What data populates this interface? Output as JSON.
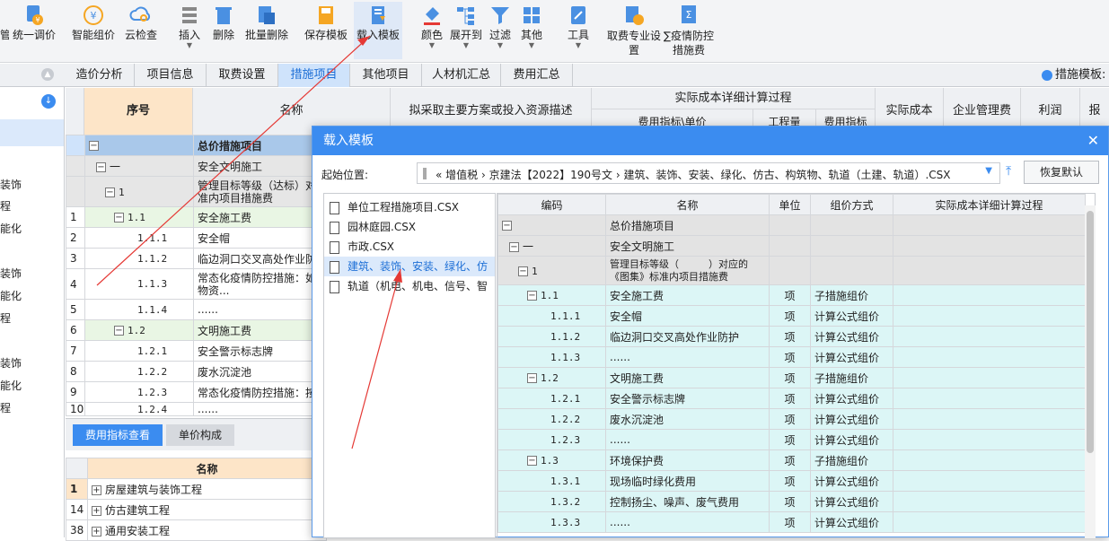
{
  "toolbar": {
    "items": [
      {
        "label": "管",
        "icon": "partial-icon"
      },
      {
        "label": "统一调价",
        "icon": "unified-price-icon"
      },
      {
        "label": "智能组价",
        "icon": "smart-pricing-icon"
      },
      {
        "label": "云检查",
        "icon": "cloud-check-icon"
      },
      {
        "label": "插入",
        "icon": "insert-icon"
      },
      {
        "label": "删除",
        "icon": "trash-icon"
      },
      {
        "label": "批量删除",
        "icon": "batch-delete-icon"
      },
      {
        "label": "保存模板",
        "icon": "save-template-icon"
      },
      {
        "label": "载入模板",
        "icon": "load-template-icon"
      },
      {
        "label": "颜色",
        "icon": "paint-bucket-icon"
      },
      {
        "label": "展开到",
        "icon": "expand-to-icon"
      },
      {
        "label": "过滤",
        "icon": "filter-icon"
      },
      {
        "label": "其他",
        "icon": "grid-icon"
      },
      {
        "label": "工具",
        "icon": "tools-icon"
      },
      {
        "label": "取费专业设置",
        "icon": "fee-settings-icon"
      },
      {
        "label": "∑疫情防控措施费",
        "icon": "epidemic-fee-icon"
      }
    ]
  },
  "tabs": [
    "造价分析",
    "项目信息",
    "取费设置",
    "措施项目",
    "其他项目",
    "人材机汇总",
    "费用汇总"
  ],
  "right_label": "措施模板:",
  "left_items": [
    "装饰",
    "程",
    "能化",
    "装饰",
    "能化",
    "程",
    "装饰",
    "能化",
    "程"
  ],
  "main": {
    "headers": {
      "seq": "序号",
      "name": "名称",
      "desc": "拟采取主要方案或投入资源描述",
      "actual": "实际成本详细计算过程",
      "unitprice": "费用指标\\单价",
      "qty": "工程量",
      "feeidx": "费用指标",
      "actual_cost": "实际成本",
      "mgmt": "企业管理费",
      "profit": "利润",
      "more": "报"
    },
    "rows": [
      {
        "num": "",
        "seq": "",
        "name": "总价措施项目"
      },
      {
        "num": "",
        "seq": "一",
        "name": "安全文明施工"
      },
      {
        "num": "",
        "seq": "1",
        "name": "管理目标等级（达标）对准内项目措施费"
      },
      {
        "num": "1",
        "seq": "1.1",
        "name": "安全施工费"
      },
      {
        "num": "2",
        "seq": "1.1.1",
        "name": "安全帽"
      },
      {
        "num": "3",
        "seq": "1.1.2",
        "name": "临边洞口交叉高处作业防"
      },
      {
        "num": "4",
        "seq": "1.1.3",
        "name": "常态化疫情防控措施：如物资..."
      },
      {
        "num": "5",
        "seq": "1.1.4",
        "name": "......"
      },
      {
        "num": "6",
        "seq": "1.2",
        "name": "文明施工费"
      },
      {
        "num": "7",
        "seq": "1.2.1",
        "name": "安全警示标志牌"
      },
      {
        "num": "8",
        "seq": "1.2.2",
        "name": "废水沉淀池"
      },
      {
        "num": "9",
        "seq": "1.2.3",
        "name": "常态化疫情防控措施：按"
      },
      {
        "num": "10",
        "seq": "1.2.4",
        "name": "......"
      }
    ]
  },
  "bottom": {
    "tabs": [
      "费用指标查看",
      "单价构成"
    ],
    "header": "名称",
    "rows": [
      {
        "num": "1",
        "name": "房屋建筑与装饰工程"
      },
      {
        "num": "14",
        "name": "仿古建筑工程"
      },
      {
        "num": "38",
        "name": "通用安装工程"
      }
    ]
  },
  "dialog": {
    "title": "载入模板",
    "start_label": "起始位置:",
    "path": "«  增值税 › 京建法【2022】190号文 › 建筑、装饰、安装、绿化、仿古、构筑物、轨道（土建、轨道）.CSX",
    "reset": "恢复默认",
    "files": [
      "单位工程措施项目.CSX",
      "园林庭园.CSX",
      "市政.CSX",
      "建筑、装饰、安装、绿化、仿",
      "轨道（机电、机电、信号、智"
    ],
    "headers": [
      "编码",
      "名称",
      "单位",
      "组价方式",
      "实际成本详细计算过程"
    ],
    "rows": [
      {
        "code": "",
        "name": "总价措施项目",
        "unit": "",
        "method": ""
      },
      {
        "code": "一",
        "name": "安全文明施工",
        "unit": "",
        "method": ""
      },
      {
        "code": "1",
        "name": "管理目标等级（　　　）对应的《图集》标准内项目措施费",
        "unit": "",
        "method": ""
      },
      {
        "code": "1.1",
        "name": "安全施工费",
        "unit": "项",
        "method": "子措施组价"
      },
      {
        "code": "1.1.1",
        "name": "安全帽",
        "unit": "项",
        "method": "计算公式组价"
      },
      {
        "code": "1.1.2",
        "name": "临边洞口交叉高处作业防护",
        "unit": "项",
        "method": "计算公式组价"
      },
      {
        "code": "1.1.3",
        "name": "......",
        "unit": "项",
        "method": "计算公式组价"
      },
      {
        "code": "1.2",
        "name": "文明施工费",
        "unit": "项",
        "method": "子措施组价"
      },
      {
        "code": "1.2.1",
        "name": "安全警示标志牌",
        "unit": "项",
        "method": "计算公式组价"
      },
      {
        "code": "1.2.2",
        "name": "废水沉淀池",
        "unit": "项",
        "method": "计算公式组价"
      },
      {
        "code": "1.2.3",
        "name": "......",
        "unit": "项",
        "method": "计算公式组价"
      },
      {
        "code": "1.3",
        "name": "环境保护费",
        "unit": "项",
        "method": "子措施组价"
      },
      {
        "code": "1.3.1",
        "name": "现场临时绿化费用",
        "unit": "项",
        "method": "计算公式组价"
      },
      {
        "code": "1.3.2",
        "name": "控制扬尘、噪声、废气费用",
        "unit": "项",
        "method": "计算公式组价"
      },
      {
        "code": "1.3.3",
        "name": "......",
        "unit": "项",
        "method": "计算公式组价"
      }
    ]
  },
  "colors": {
    "accent": "#3b8cf0",
    "annotation": "#e53935",
    "highlight": "#dcf6f6",
    "header_orange": "#fde5c8"
  }
}
